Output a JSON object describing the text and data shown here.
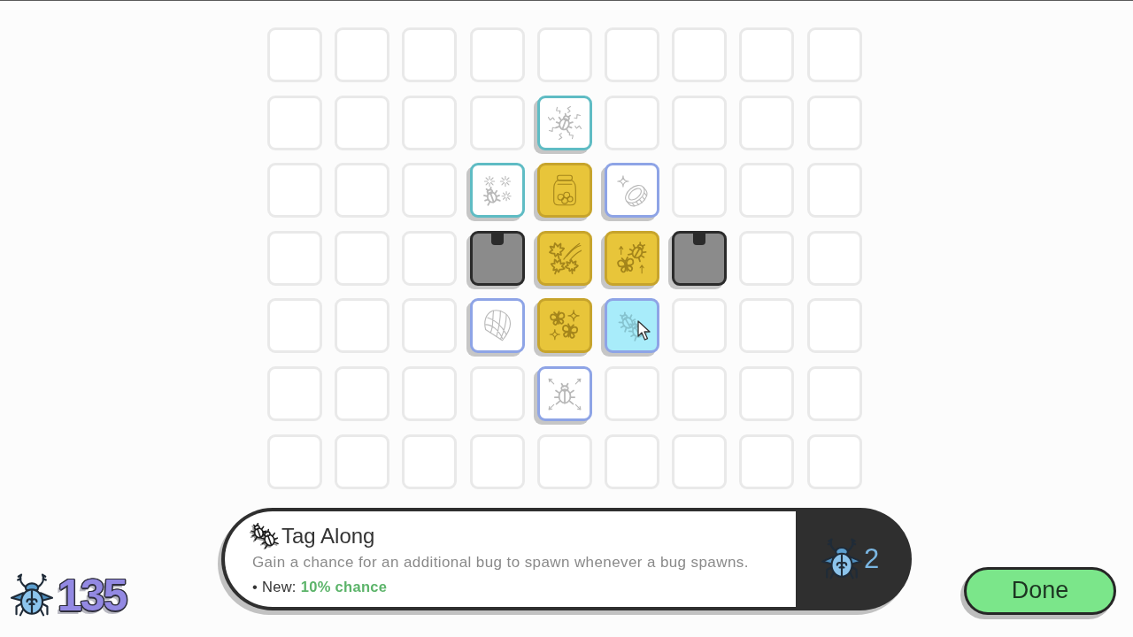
{
  "board": {
    "rows": [
      [
        {
          "kind": "empty"
        },
        {
          "kind": "empty"
        },
        {
          "kind": "empty"
        },
        {
          "kind": "empty"
        },
        {
          "kind": "empty"
        },
        {
          "kind": "empty"
        },
        {
          "kind": "empty"
        },
        {
          "kind": "empty"
        },
        {
          "kind": "empty"
        }
      ],
      [
        {
          "kind": "empty"
        },
        {
          "kind": "empty"
        },
        {
          "kind": "empty"
        },
        {
          "kind": "empty"
        },
        {
          "kind": "offer",
          "color": "#5fbcc4",
          "selected": false
        },
        {
          "kind": "empty"
        },
        {
          "kind": "empty"
        },
        {
          "kind": "empty"
        },
        {
          "kind": "empty"
        }
      ],
      [
        {
          "kind": "empty"
        },
        {
          "kind": "empty"
        },
        {
          "kind": "empty"
        },
        {
          "kind": "offer",
          "color": "#5fbcc4",
          "selected": false
        },
        {
          "kind": "owned",
          "selected": false
        },
        {
          "kind": "offer",
          "color": "#8ea4e6",
          "selected": false
        },
        {
          "kind": "empty"
        },
        {
          "kind": "empty"
        },
        {
          "kind": "empty"
        }
      ],
      [
        {
          "kind": "empty"
        },
        {
          "kind": "empty"
        },
        {
          "kind": "empty"
        },
        {
          "kind": "locked"
        },
        {
          "kind": "owned",
          "selected": false
        },
        {
          "kind": "owned",
          "selected": false
        },
        {
          "kind": "locked"
        },
        {
          "kind": "empty"
        },
        {
          "kind": "empty"
        }
      ],
      [
        {
          "kind": "empty"
        },
        {
          "kind": "empty"
        },
        {
          "kind": "empty"
        },
        {
          "kind": "offer",
          "color": "#8ea4e6",
          "selected": false
        },
        {
          "kind": "owned",
          "selected": false
        },
        {
          "kind": "offer",
          "color": "#8ea4e6",
          "selected": true
        },
        {
          "kind": "empty"
        },
        {
          "kind": "empty"
        },
        {
          "kind": "empty"
        }
      ],
      [
        {
          "kind": "empty"
        },
        {
          "kind": "empty"
        },
        {
          "kind": "empty"
        },
        {
          "kind": "empty"
        },
        {
          "kind": "offer",
          "color": "#8ea4e6",
          "selected": false
        },
        {
          "kind": "empty"
        },
        {
          "kind": "empty"
        },
        {
          "kind": "empty"
        },
        {
          "kind": "empty"
        }
      ],
      [
        {
          "kind": "empty"
        },
        {
          "kind": "empty"
        },
        {
          "kind": "empty"
        },
        {
          "kind": "empty"
        },
        {
          "kind": "empty"
        },
        {
          "kind": "empty"
        },
        {
          "kind": "empty"
        },
        {
          "kind": "empty"
        },
        {
          "kind": "empty"
        }
      ]
    ]
  },
  "upgrade_panel": {
    "title": "Tag Along",
    "description": "Gain a chance for an additional bug to spawn whenever a bug spawns.",
    "effect_label": "• New:",
    "effect_value": "10% chance",
    "cost": "2"
  },
  "currency": {
    "count": "135"
  },
  "done_button": {
    "label": "Done"
  }
}
